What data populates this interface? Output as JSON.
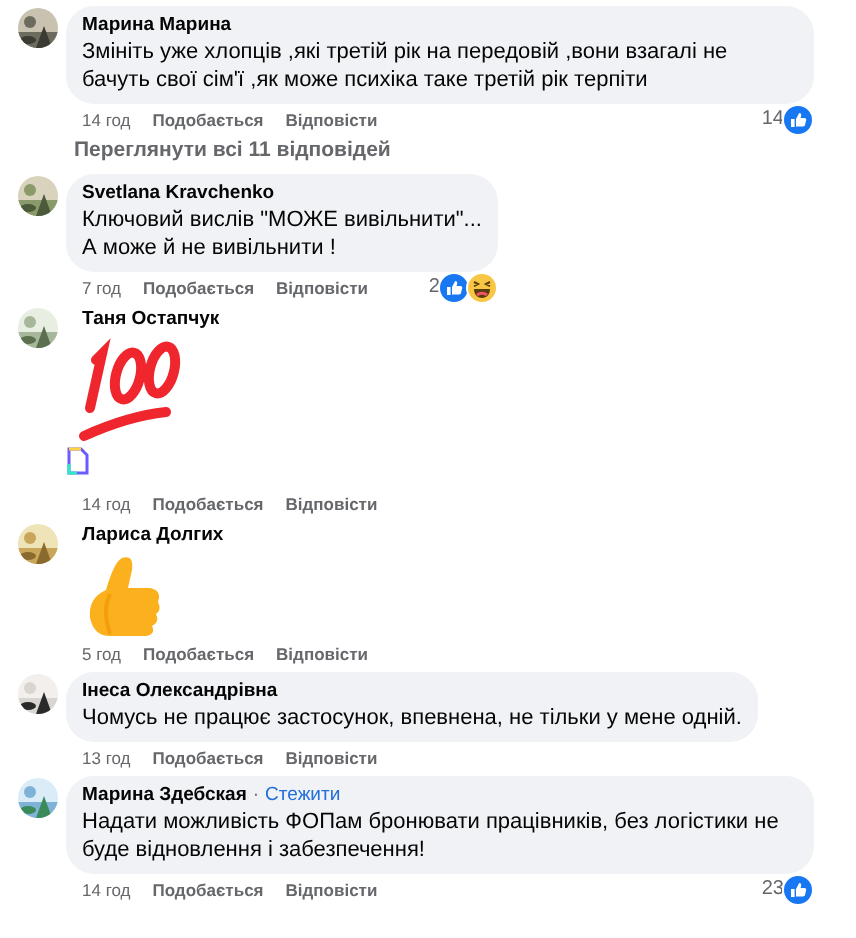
{
  "items": [
    {
      "kind": "comment",
      "author": "Марина Марина",
      "body": {
        "kind": "text",
        "text": "Змініть уже хлопців ,які третій рік на передовій ,вони взагалі не бачуть свої сім'ї ,як може психіка таке третій рік терпіти"
      },
      "broken_attachment": false,
      "time": "14 год",
      "like": "Подобається",
      "reply": "Відповісти",
      "reactions": {
        "count": "14",
        "icons": [
          {
            "kind": "like"
          }
        ]
      }
    },
    {
      "kind": "more_replies",
      "label": "Переглянути всі 11 відповідей"
    },
    {
      "kind": "comment",
      "author": "Svetlana Kravchenko",
      "body": {
        "kind": "text",
        "text": "Ключовий вислів \"МОЖЕ вивільнити\"...\nА може й не вивільнити !"
      },
      "broken_attachment": false,
      "time": "7 год",
      "like": "Подобається",
      "reply": "Відповісти",
      "reactions": {
        "count": "2",
        "icons": [
          {
            "kind": "like"
          },
          {
            "kind": "haha"
          }
        ]
      }
    },
    {
      "kind": "comment",
      "author": "Таня Остапчук",
      "body": {
        "kind": "hundred"
      },
      "broken_attachment": true,
      "time": "14 год",
      "like": "Подобається",
      "reply": "Відповісти"
    },
    {
      "kind": "comment",
      "author": "Лариса Долгих",
      "body": {
        "kind": "thumbsup"
      },
      "broken_attachment": false,
      "time": "5 год",
      "like": "Подобається",
      "reply": "Відповісти"
    },
    {
      "kind": "comment",
      "author": "Інеса Олександрівна",
      "body": {
        "kind": "text",
        "text": "Чомусь не працює застосунок, впевнена, не тільки у мене одній."
      },
      "broken_attachment": false,
      "time": "13 год",
      "like": "Подобається",
      "reply": "Відповісти"
    },
    {
      "kind": "comment",
      "author": "Марина Здебская",
      "separator": "·",
      "follow": "Стежити",
      "body": {
        "kind": "text",
        "text": "Надати можливість ФОПам бронювати працівників, без логістики не буде відновлення і забезпечення!"
      },
      "broken_attachment": false,
      "time": "14 год",
      "like": "Подобається",
      "reply": "Відповісти",
      "reactions": {
        "count": "23",
        "icons": [
          {
            "kind": "like"
          }
        ]
      }
    }
  ]
}
